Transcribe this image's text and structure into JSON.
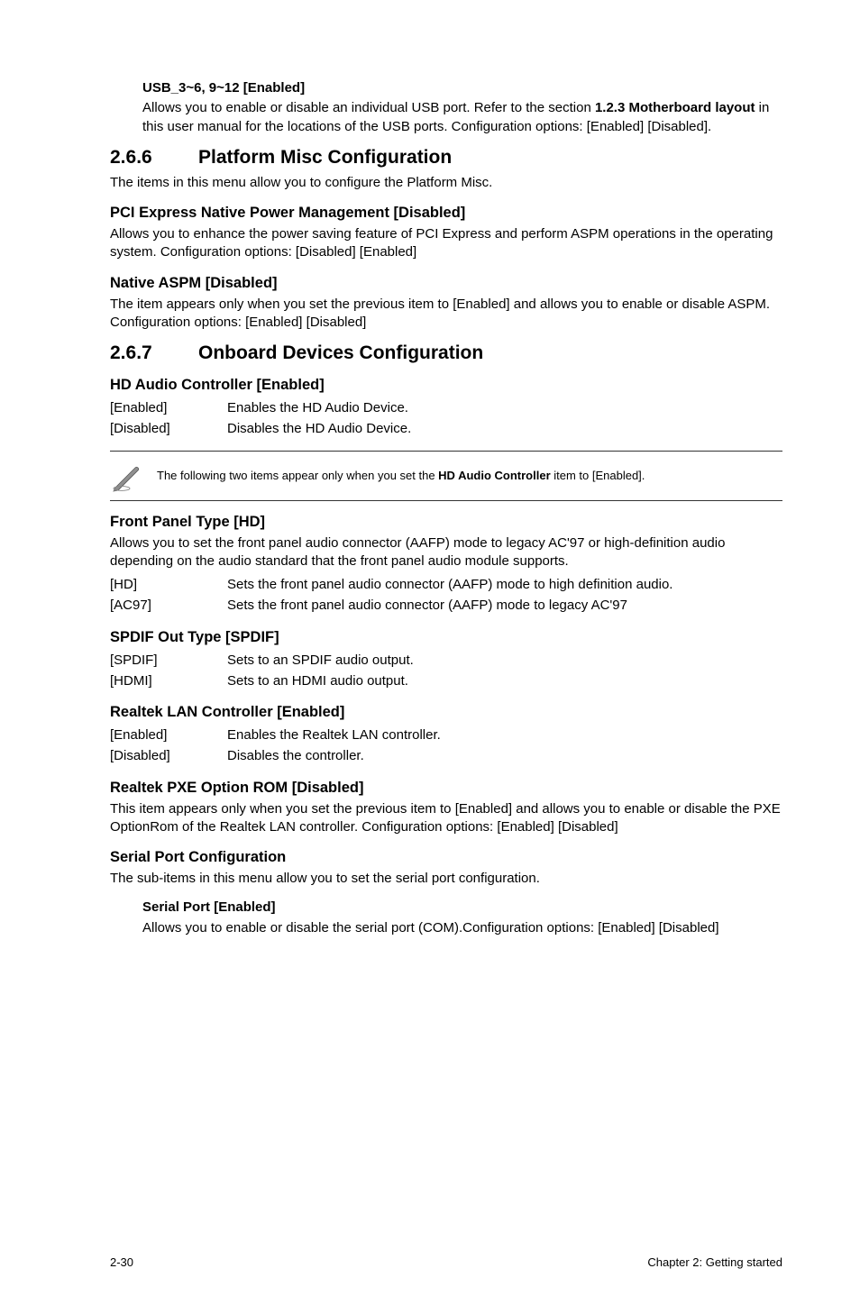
{
  "usb_block": {
    "title": "USB_3~6, 9~12 [Enabled]",
    "body_1": "Allows you to enable or disable an individual USB port. Refer to the section ",
    "body_strong": "1.2.3 Motherboard layout",
    "body_2": " in this user manual for the locations of the USB ports. Configuration options: [Enabled] [Disabled]."
  },
  "sec266": {
    "number": "2.6.6",
    "title": "Platform Misc Configuration",
    "lead": "The items in this menu allow you to configure the Platform Misc.",
    "pci": {
      "title": "PCI Express Native Power Management [Disabled]",
      "body": "Allows you to enhance the power saving feature of PCI Express and perform ASPM operations in the operating system. Configuration options: [Disabled] [Enabled]"
    },
    "native_aspm": {
      "title": "Native ASPM [Disabled]",
      "body": "The item appears only when you set the previous item to [Enabled] and allows you to enable or disable ASPM. Configuration options: [Enabled] [Disabled]"
    }
  },
  "sec267": {
    "number": "2.6.7",
    "title": "Onboard Devices Configuration",
    "hd_audio": {
      "title": "HD Audio Controller [Enabled]",
      "rows": [
        {
          "key": "[Enabled]",
          "val": "Enables the HD Audio Device."
        },
        {
          "key": "[Disabled]",
          "val": "Disables the HD Audio Device."
        }
      ]
    },
    "note": {
      "pre": "The following two items appear only when you set the ",
      "strong": "HD Audio Controller",
      "post": " item to [Enabled]."
    },
    "front_panel": {
      "title": "Front Panel Type [HD]",
      "body": "Allows you to set the front panel audio connector (AAFP) mode to legacy AC'97 or high-definition audio depending on the audio standard that the front panel audio module supports.",
      "rows": [
        {
          "key": "[HD]",
          "val": "Sets the front panel audio connector (AAFP) mode to high definition audio."
        },
        {
          "key": "[AC97]",
          "val": "Sets the front panel audio connector (AAFP) mode to legacy AC'97"
        }
      ]
    },
    "spdif": {
      "title": "SPDIF Out Type [SPDIF]",
      "rows": [
        {
          "key": "[SPDIF]",
          "val": "Sets to an SPDIF audio output."
        },
        {
          "key": "[HDMI]",
          "val": "Sets to an HDMI audio output."
        }
      ]
    },
    "realtek_lan": {
      "title": "Realtek LAN Controller [Enabled]",
      "rows": [
        {
          "key": "[Enabled]",
          "val": "Enables the Realtek LAN controller."
        },
        {
          "key": "[Disabled]",
          "val": "Disables the controller."
        }
      ]
    },
    "pxe": {
      "title": "Realtek PXE Option ROM [Disabled]",
      "body": "This item appears only when you set the previous item to [Enabled] and allows you to enable or disable the PXE OptionRom of the Realtek LAN controller. Configuration options: [Enabled] [Disabled]"
    },
    "serial_cfg": {
      "title": "Serial Port Configuration",
      "body": "The sub-items in this menu allow you to set the serial port configuration.",
      "serial_port": {
        "title": "Serial Port [Enabled]",
        "body": "Allows you to enable or disable the serial port (COM).Configuration options: [Enabled] [Disabled]"
      }
    }
  },
  "footer": {
    "left": "2-30",
    "right": "Chapter 2: Getting started"
  }
}
